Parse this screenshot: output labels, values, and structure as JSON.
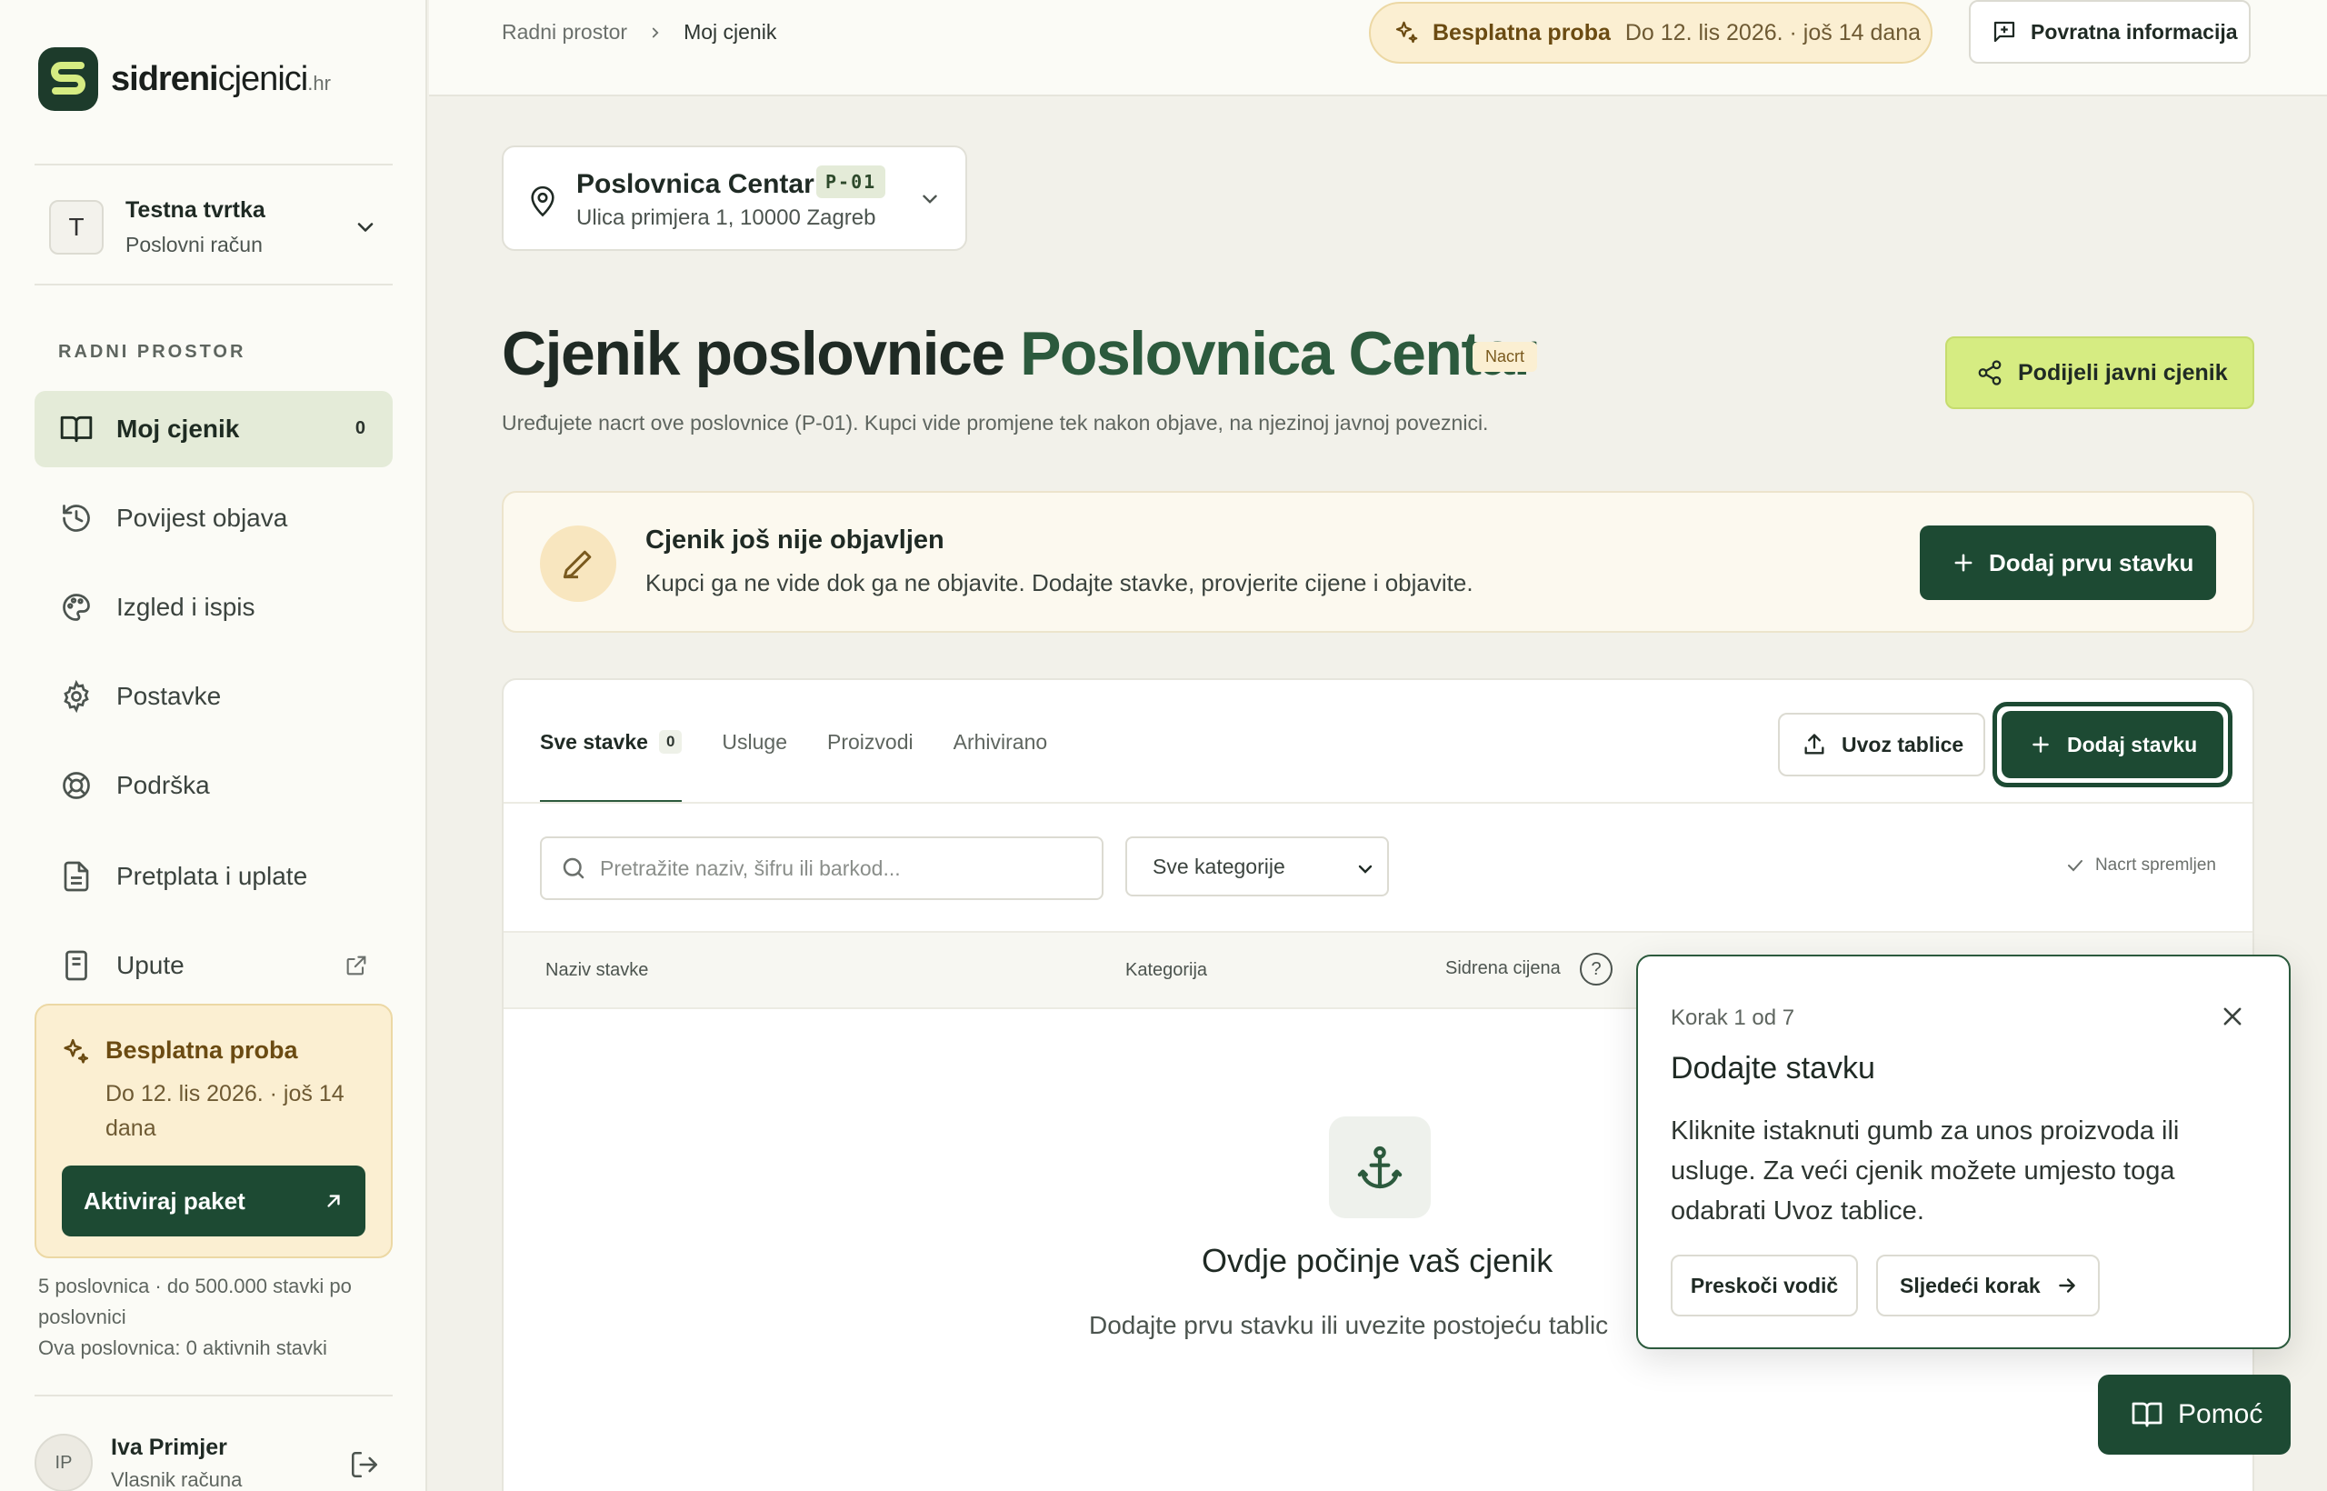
{
  "brand": {
    "name_bold": "sidreni",
    "name_rest": "cjenici",
    "tld": ".hr"
  },
  "account": {
    "initial": "T",
    "name": "Testna tvrtka",
    "type": "Poslovni račun"
  },
  "sidebar": {
    "section_label": "RADNI PROSTOR",
    "items": [
      {
        "label": "Moj cjenik",
        "icon": "book-open-icon",
        "badge": "0",
        "active": true
      },
      {
        "label": "Povijest objava",
        "icon": "history-icon"
      },
      {
        "label": "Izgled i ispis",
        "icon": "palette-icon"
      },
      {
        "label": "Postavke",
        "icon": "gear-icon"
      },
      {
        "label": "Podrška",
        "icon": "lifebuoy-icon"
      },
      {
        "label": "Pretplata i uplate",
        "icon": "document-icon"
      },
      {
        "label": "Upute",
        "icon": "notebook-icon",
        "external": true
      }
    ],
    "trial": {
      "title": "Besplatna proba",
      "date": "Do 12. lis 2026. · još 14 dana",
      "cta": "Aktiviraj paket"
    },
    "limits_line1": "5 poslovnica · do 500.000 stavki po poslovnici",
    "limits_line2": "Ova poslovnica: 0 aktivnih stavki",
    "user": {
      "initials": "IP",
      "name": "Iva Primjer",
      "role": "Vlasnik računa"
    }
  },
  "topbar": {
    "breadcrumb_root": "Radni prostor",
    "breadcrumb_current": "Moj cjenik",
    "trial_label": "Besplatna proba",
    "trial_date": "Do 12. lis 2026. · još 14 dana",
    "feedback_label": "Povratna informacija"
  },
  "location": {
    "name": "Poslovnica Centar",
    "code": "P-01",
    "address": "Ulica primjera 1, 10000 Zagreb"
  },
  "page": {
    "title_prefix": "Cjenik poslovnice",
    "title_accent": "Poslovnica Centar",
    "status_badge": "Nacrt",
    "subtitle": "Uređujete nacrt ove poslovnice (P-01). Kupci vide promjene tek nakon objave, na njezinoj javnoj poveznici.",
    "share_label": "Podijeli javni cjenik"
  },
  "notice": {
    "title": "Cjenik još nije objavljen",
    "text": "Kupci ga ne vide dok ga ne objavite. Dodajte stavke, provjerite cijene i objavite.",
    "cta": "Dodaj prvu stavku"
  },
  "table": {
    "tabs": [
      {
        "label": "Sve stavke",
        "count": "0",
        "active": true
      },
      {
        "label": "Usluge"
      },
      {
        "label": "Proizvodi"
      },
      {
        "label": "Arhivirano"
      }
    ],
    "import_label": "Uvoz tablice",
    "add_label": "Dodaj stavku",
    "search_placeholder": "Pretražite naziv, šifru ili barkod...",
    "category_selected": "Sve kategorije",
    "saved_status": "Nacrt spremljen",
    "columns": [
      "Naziv stavke",
      "Kategorija",
      "Sidrena cijena"
    ],
    "help_mark": "?",
    "empty_title": "Ovdje počinje vaš cjenik",
    "empty_text": "Dodajte prvu stavku ili uvezite postojeću tablic"
  },
  "tour": {
    "step": "Korak 1 od 7",
    "title": "Dodajte stavku",
    "text": "Kliknite istaknuti gumb za unos proizvoda ili usluge. Za veći cjenik možete umjesto toga odabrati Uvoz tablice.",
    "skip": "Preskoči vodič",
    "next": "Sljedeći korak"
  },
  "help_button": "Pomoć",
  "colors": {
    "primary": "#1d4a33",
    "accent_green": "#2c5a3d",
    "lime": "#d6ec82",
    "trial_bg": "#fbefd2",
    "trial_text": "#6b4b12"
  }
}
